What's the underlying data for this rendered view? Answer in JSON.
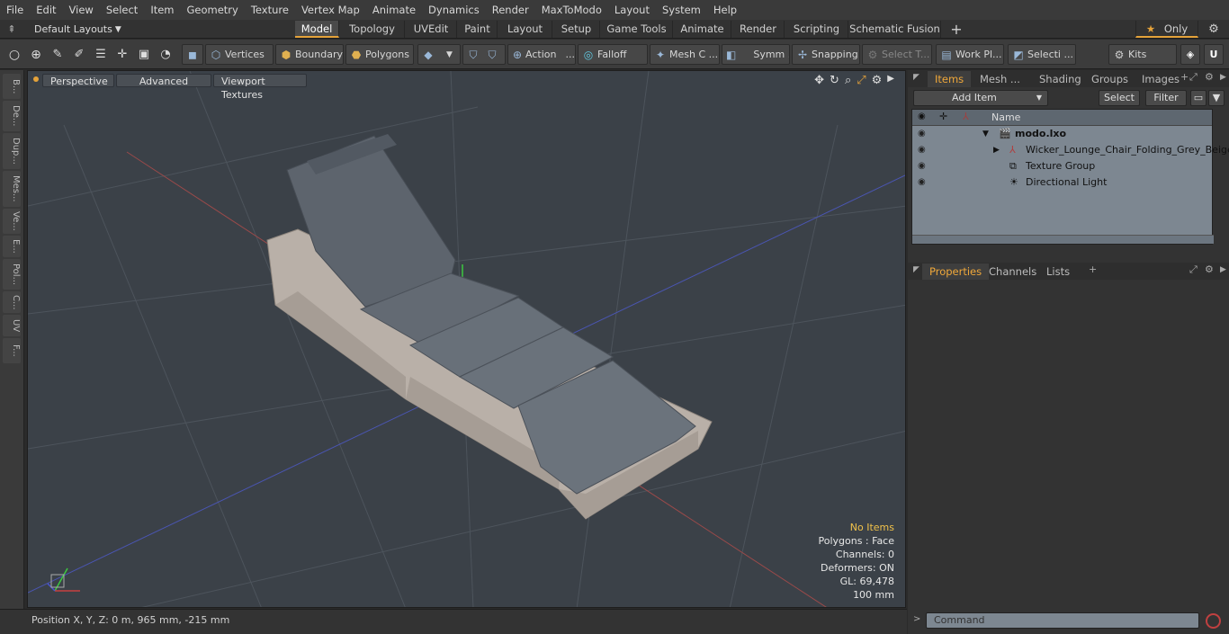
{
  "menu": [
    "File",
    "Edit",
    "View",
    "Select",
    "Item",
    "Geometry",
    "Texture",
    "Vertex Map",
    "Animate",
    "Dynamics",
    "Render",
    "MaxToModo",
    "Layout",
    "System",
    "Help"
  ],
  "layout_selector": "Default Layouts",
  "layout_tabs": [
    "Model",
    "Topology",
    "UVEdit",
    "Paint",
    "Layout",
    "Setup",
    "Game Tools",
    "Animate",
    "Render",
    "Scripting",
    "Schematic Fusion"
  ],
  "active_layout_tab": "Model",
  "only_label": "Only",
  "toolbar": {
    "vertices": "Vertices",
    "boundary": "Boundary",
    "polygons": "Polygons",
    "action": "Action",
    "falloff": "Falloff",
    "mesh": "Mesh C ...",
    "symm": "Symm ...",
    "snapping": "Snapping",
    "select_t": "Select T...",
    "work_pl": "Work Pl...",
    "selecti": "Selecti ...",
    "kits": "Kits"
  },
  "left_tabs": [
    "B...",
    "De...",
    "Dup...",
    "Mes...",
    "Ve...",
    "E...",
    "Pol...",
    "C...",
    "UV",
    "F..."
  ],
  "viewport": {
    "perspective": "Perspective",
    "advanced": "Advanced",
    "textures": "Viewport Textures",
    "info": {
      "no_items": "No Items",
      "polygons": "Polygons : Face",
      "channels": "Channels: 0",
      "deformers": "Deformers: ON",
      "gl": "GL: 69,478",
      "scale": "100 mm"
    }
  },
  "status": "Position X, Y, Z:   0 m, 965 mm, -215 mm",
  "items_panel": {
    "tabs": [
      "Items",
      "Mesh ...",
      "Shading",
      "Groups",
      "Images"
    ],
    "add_item": "Add Item",
    "select": "Select",
    "filter": "Filter",
    "name_header": "Name",
    "rows": [
      "modo.lxo",
      "Wicker_Lounge_Chair_Folding_Grey_Beige",
      "Texture Group",
      "Directional Light"
    ]
  },
  "properties_panel": {
    "tabs": [
      "Properties",
      "Channels",
      "Lists"
    ]
  },
  "command_placeholder": "Command",
  "colors": {
    "accent": "#e4a23a",
    "viewport_bg": "#3b4148",
    "tree_bg": "#7d8791"
  }
}
